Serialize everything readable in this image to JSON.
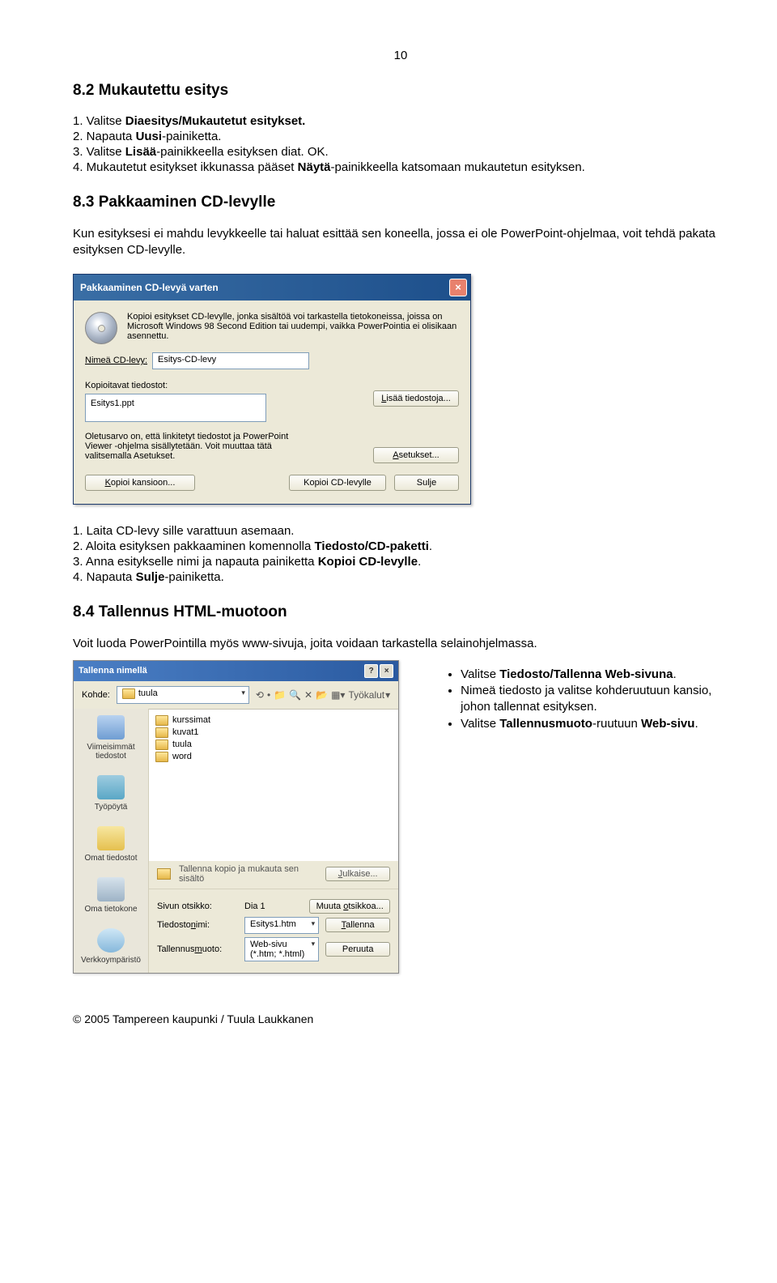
{
  "page_number": "10",
  "section_8_2": {
    "heading": "8.2 Mukautettu esitys",
    "s1_a": "1. Valitse ",
    "s1_b": "Diaesitys/Mukautetut esitykset.",
    "s2_a": "2. Napauta ",
    "s2_b": "Uusi",
    "s2_c": "-painiketta.",
    "s3_a": "3. Valitse ",
    "s3_b": "Lisää",
    "s3_c": "-painikkeella esityksen diat. OK.",
    "s4_a": "4. Mukautetut esitykset ikkunassa pääset ",
    "s4_b": "Näytä",
    "s4_c": "-painikkeella katsomaan mukautetun esityksen."
  },
  "section_8_3": {
    "heading": "8.3 Pakkaaminen CD-levylle",
    "intro": "Kun esityksesi ei mahdu levykkeelle tai haluat esittää sen koneella, jossa ei ole PowerPoint-ohjelmaa, voit tehdä pakata esityksen CD-levylle.",
    "s1": "1. Laita CD-levy sille varattuun asemaan.",
    "s2_a": "2. Aloita esityksen pakkaaminen komennolla ",
    "s2_b": "Tiedosto/CD-paketti",
    "s2_c": ".",
    "s3_a": "3. Anna esitykselle nimi ja napauta painiketta ",
    "s3_b": "Kopioi CD-levylle",
    "s3_c": ".",
    "s4_a": "4. Napauta ",
    "s4_b": "Sulje",
    "s4_c": "-painiketta."
  },
  "section_8_4": {
    "heading": "8.4 Tallennus HTML-muotoon",
    "intro": "Voit luoda PowerPointilla myös www-sivuja, joita voidaan tarkastella selainohjelmassa.",
    "b1_a": "Valitse ",
    "b1_b": "Tiedosto/Tallenna Web-sivuna",
    "b1_c": ".",
    "b2": "Nimeä tiedosto ja valitse kohde­ruutuun kansio, johon tallennat esityksen.",
    "b3_a": "Valitse ",
    "b3_b": "Tallennusmuoto",
    "b3_c": "-ruutuun ",
    "b3_d": "Web-sivu",
    "b3_e": "."
  },
  "dialog1": {
    "title": "Pakkaaminen CD-levyä varten",
    "intro": "Kopioi esitykset CD-levylle, jonka sisältöä voi tarkastella tietokoneissa, joissa on Microsoft Windows 98 Second Edition tai uudempi, vaikka PowerPointia ei olisikaan asennettu.",
    "nimea_label_pre": "N",
    "nimea_label": "imeä CD-levy:",
    "nimea_value": "Esitys-CD-levy",
    "files_label": "Kopioitavat tiedostot:",
    "file1": "Esitys1.ppt",
    "btn_lisaa": "Lisää tiedostoja...",
    "options_text": "Oletusarvo on, että linkitetyt tiedostot ja PowerPoint Viewer -ohjelma sisällytetään. Voit muuttaa tätä valitsemalla Asetukset.",
    "btn_asetukset": "Asetukset...",
    "btn_kopioi_kansioon": "Kopioi kansioon...",
    "btn_kopioi_cd": "Kopioi CD-levylle",
    "btn_sulje": "Sulje"
  },
  "dialog2": {
    "title": "Tallenna nimellä",
    "kohde_label": "Kohde:",
    "kohde_value": "tuula",
    "tyokalut": "Työkalut",
    "places": {
      "recent": "Viimeisimmät tiedostot",
      "desktop": "Työpöytä",
      "docs": "Omat tiedostot",
      "comp": "Oma tietokone",
      "net": "Verkkoympäristö"
    },
    "folders": [
      "kurssimat",
      "kuvat1",
      "tuula",
      "word"
    ],
    "mid_label": "Tallenna kopio ja mukauta sen sisältö",
    "btn_julkaise": "Julkaise...",
    "row_otsikko_label": "Sivun otsikko:",
    "row_otsikko_value": "Dia 1",
    "btn_muuta_otsikkoa": "Muuta otsikkoa...",
    "row_tiedosto_label": "Tiedostonimi:",
    "row_tiedosto_value": "Esitys1.htm",
    "btn_tallenna": "Tallenna",
    "row_muoto_label": "Tallennusmuoto:",
    "row_muoto_value": "Web-sivu (*.htm; *.html)",
    "btn_peruuta": "Peruuta"
  },
  "footer": "© 2005 Tampereen kaupunki / Tuula Laukkanen"
}
